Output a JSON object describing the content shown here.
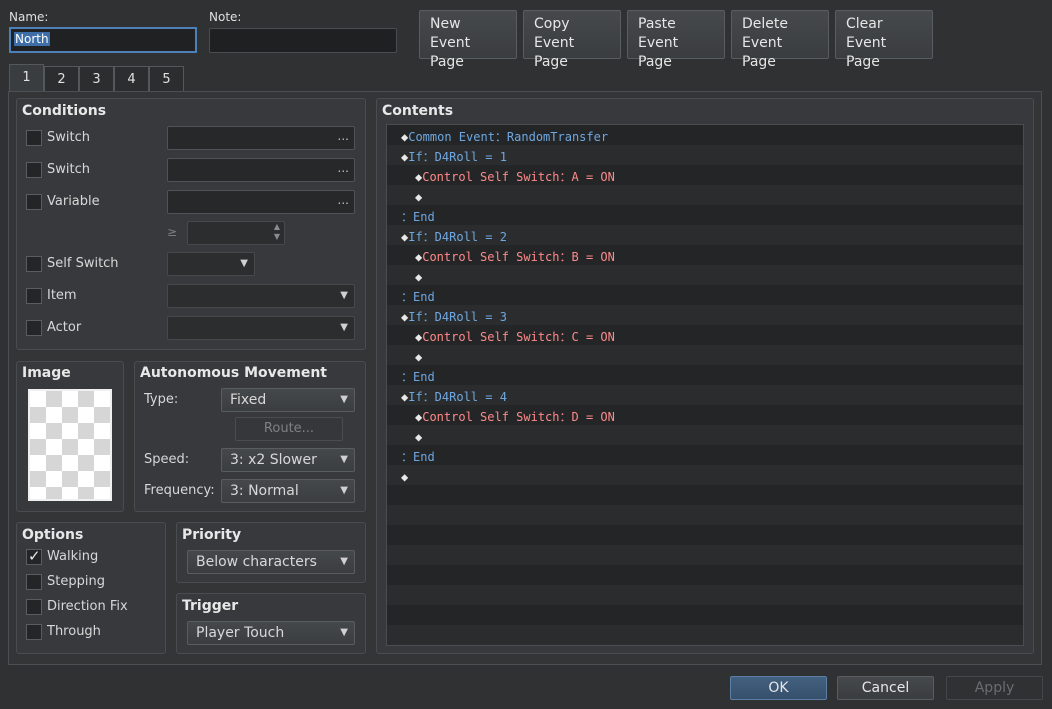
{
  "header": {
    "name_label": "Name:",
    "name_value": "North",
    "note_label": "Note:",
    "note_value": "",
    "buttons": [
      {
        "line1": "New",
        "line2": "Event Page"
      },
      {
        "line1": "Copy",
        "line2": "Event Page"
      },
      {
        "line1": "Paste",
        "line2": "Event Page"
      },
      {
        "line1": "Delete",
        "line2": "Event Page"
      },
      {
        "line1": "Clear",
        "line2": "Event Page"
      }
    ]
  },
  "tabs": [
    "1",
    "2",
    "3",
    "4",
    "5"
  ],
  "active_tab": "1",
  "conditions": {
    "title": "Conditions",
    "switch1": "Switch",
    "switch2": "Switch",
    "variable": "Variable",
    "ge_symbol": "≥",
    "self_switch": "Self Switch",
    "item": "Item",
    "actor": "Actor",
    "dots": "..."
  },
  "image": {
    "title": "Image"
  },
  "movement": {
    "title": "Autonomous Movement",
    "type_label": "Type:",
    "type_value": "Fixed",
    "route_button": "Route...",
    "speed_label": "Speed:",
    "speed_value": "3: x2 Slower",
    "freq_label": "Frequency:",
    "freq_value": "3: Normal"
  },
  "options": {
    "title": "Options",
    "walking": "Walking",
    "stepping": "Stepping",
    "direction_fix": "Direction Fix",
    "through": "Through",
    "walking_checked": true
  },
  "priority": {
    "title": "Priority",
    "value": "Below characters"
  },
  "trigger": {
    "title": "Trigger",
    "value": "Player Touch"
  },
  "contents": {
    "title": "Contents",
    "lines": [
      {
        "indent": 0,
        "marker": "◆",
        "text": "Common Event：RandomTransfer",
        "color": "blue"
      },
      {
        "indent": 0,
        "marker": "◆",
        "text": "If：D4Roll = 1",
        "color": "blue"
      },
      {
        "indent": 1,
        "marker": "◆",
        "text": "Control Self Switch：A = ON",
        "color": "red"
      },
      {
        "indent": 1,
        "marker": "◆",
        "text": "",
        "color": "dia"
      },
      {
        "indent": 0,
        "marker": "：",
        "text": "End",
        "color": "blue"
      },
      {
        "indent": 0,
        "marker": "◆",
        "text": "If：D4Roll = 2",
        "color": "blue"
      },
      {
        "indent": 1,
        "marker": "◆",
        "text": "Control Self Switch：B = ON",
        "color": "red"
      },
      {
        "indent": 1,
        "marker": "◆",
        "text": "",
        "color": "dia"
      },
      {
        "indent": 0,
        "marker": "：",
        "text": "End",
        "color": "blue"
      },
      {
        "indent": 0,
        "marker": "◆",
        "text": "If：D4Roll = 3",
        "color": "blue"
      },
      {
        "indent": 1,
        "marker": "◆",
        "text": "Control Self Switch：C = ON",
        "color": "red"
      },
      {
        "indent": 1,
        "marker": "◆",
        "text": "",
        "color": "dia"
      },
      {
        "indent": 0,
        "marker": "：",
        "text": "End",
        "color": "blue"
      },
      {
        "indent": 0,
        "marker": "◆",
        "text": "If：D4Roll = 4",
        "color": "blue"
      },
      {
        "indent": 1,
        "marker": "◆",
        "text": "Control Self Switch：D = ON",
        "color": "red"
      },
      {
        "indent": 1,
        "marker": "◆",
        "text": "",
        "color": "dia"
      },
      {
        "indent": 0,
        "marker": "：",
        "text": "End",
        "color": "blue"
      },
      {
        "indent": 0,
        "marker": "◆",
        "text": "",
        "color": "dia"
      }
    ]
  },
  "footer": {
    "ok": "OK",
    "cancel": "Cancel",
    "apply": "Apply"
  }
}
